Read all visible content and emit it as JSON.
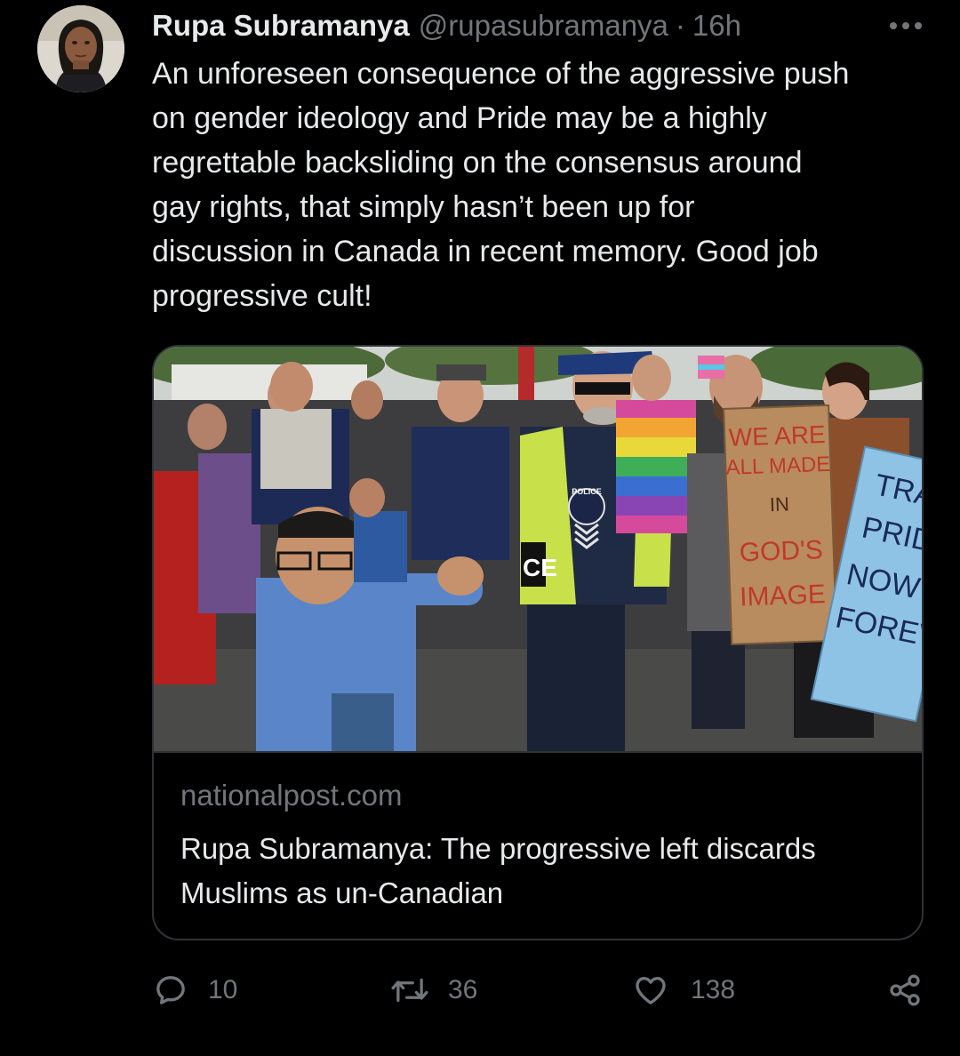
{
  "tweet": {
    "author": {
      "display_name": "Rupa Subramanya",
      "handle": "@rupasubramanya",
      "separator": "·",
      "time": "16h"
    },
    "text": "An unforeseen consequence of the aggressive push\non gender ideology and Pride may be a highly\nregrettable backsliding on the consensus around\ngay rights, that simply hasn’t been up for\ndiscussion in Canada in recent memory. Good job\nprogressive cult!",
    "card": {
      "image_signs": {
        "sign_left_lines": [
          "WE ARE",
          "ALL MADE",
          "IN",
          "GOD'S",
          "IMAGE"
        ],
        "sign_right_lines": [
          "TRA",
          "PRID",
          "NOW F",
          "FOREV"
        ],
        "police_patch": "POLICE",
        "vest_text": "CE"
      },
      "domain": "nationalpost.com",
      "title": "Rupa Subramanya: The progressive left discards Muslims as un-Canadian"
    },
    "actions": {
      "replies": "10",
      "retweets": "36",
      "likes": "138"
    },
    "icons": {
      "reply": "reply-icon",
      "retweet": "retweet-icon",
      "like": "heart-icon",
      "share": "share-icon",
      "more": "more-icon"
    },
    "colors": {
      "background": "#000000",
      "text": "#e7e9ea",
      "secondary": "#71767b",
      "border": "#2f3336"
    }
  }
}
